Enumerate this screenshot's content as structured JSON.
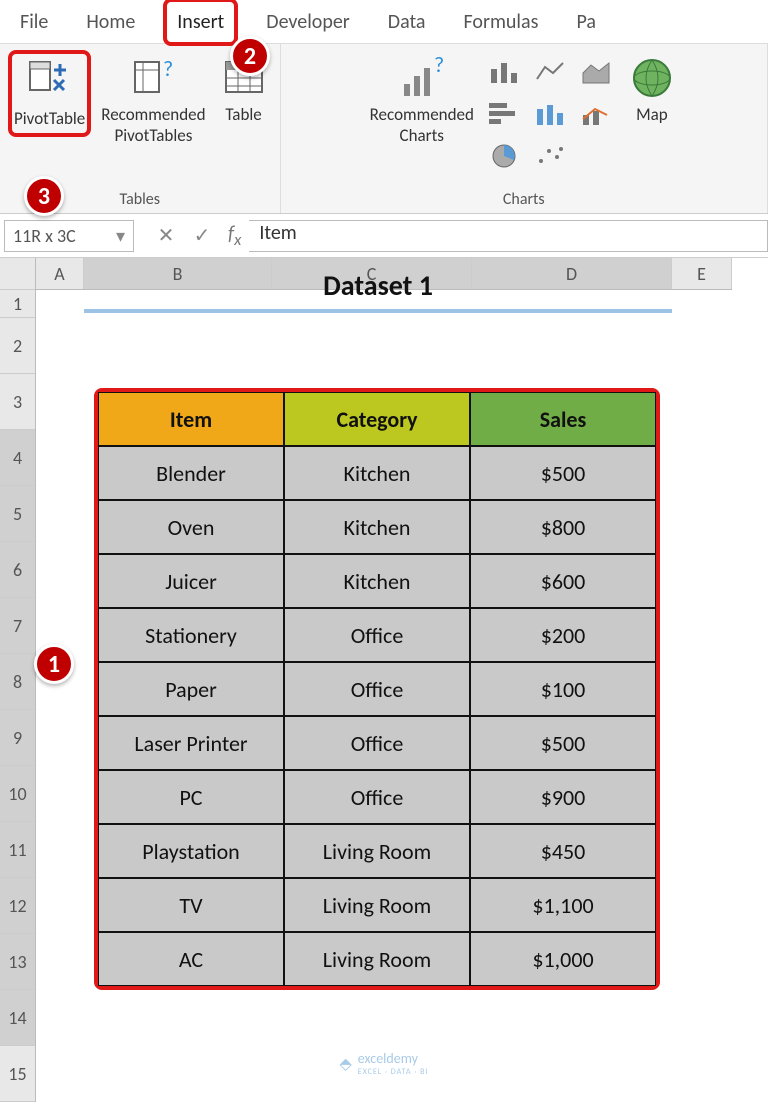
{
  "tabs": [
    "File",
    "Home",
    "Insert",
    "Developer",
    "Data",
    "Formulas",
    "Pa"
  ],
  "active_tab": "Insert",
  "ribbon": {
    "tables_group": "Tables",
    "pivot": "PivotTable",
    "recommended_pivot": "Recommended\nPivotTables",
    "table": "Table",
    "charts_group": "Charts",
    "rec_charts": "Recommended\nCharts",
    "maps": "Map"
  },
  "formula": {
    "name_box": "11R x 3C",
    "value": "Item"
  },
  "columns": [
    "A",
    "B",
    "C",
    "D",
    "E"
  ],
  "rows": [
    "1",
    "2",
    "3",
    "4",
    "5",
    "6",
    "7",
    "8",
    "9",
    "10",
    "11",
    "12",
    "13",
    "14",
    "15"
  ],
  "dataset_title": "Dataset 1",
  "headers": {
    "item": "Item",
    "category": "Category",
    "sales": "Sales"
  },
  "data": [
    {
      "item": "Blender",
      "category": "Kitchen",
      "sales": "$500"
    },
    {
      "item": "Oven",
      "category": "Kitchen",
      "sales": "$800"
    },
    {
      "item": "Juicer",
      "category": "Kitchen",
      "sales": "$600"
    },
    {
      "item": "Stationery",
      "category": "Office",
      "sales": "$200"
    },
    {
      "item": "Paper",
      "category": "Office",
      "sales": "$100"
    },
    {
      "item": "Laser Printer",
      "category": "Office",
      "sales": "$500"
    },
    {
      "item": "PC",
      "category": "Office",
      "sales": "$900"
    },
    {
      "item": "Playstation",
      "category": "Living Room",
      "sales": "$450"
    },
    {
      "item": "TV",
      "category": "Living Room",
      "sales": "$1,100"
    },
    {
      "item": "AC",
      "category": "Living Room",
      "sales": "$1,000"
    }
  ],
  "callouts": {
    "c1": "1",
    "c2": "2",
    "c3": "3"
  },
  "watermark": {
    "brand": "exceldemy",
    "sub": "EXCEL · DATA · BI"
  }
}
